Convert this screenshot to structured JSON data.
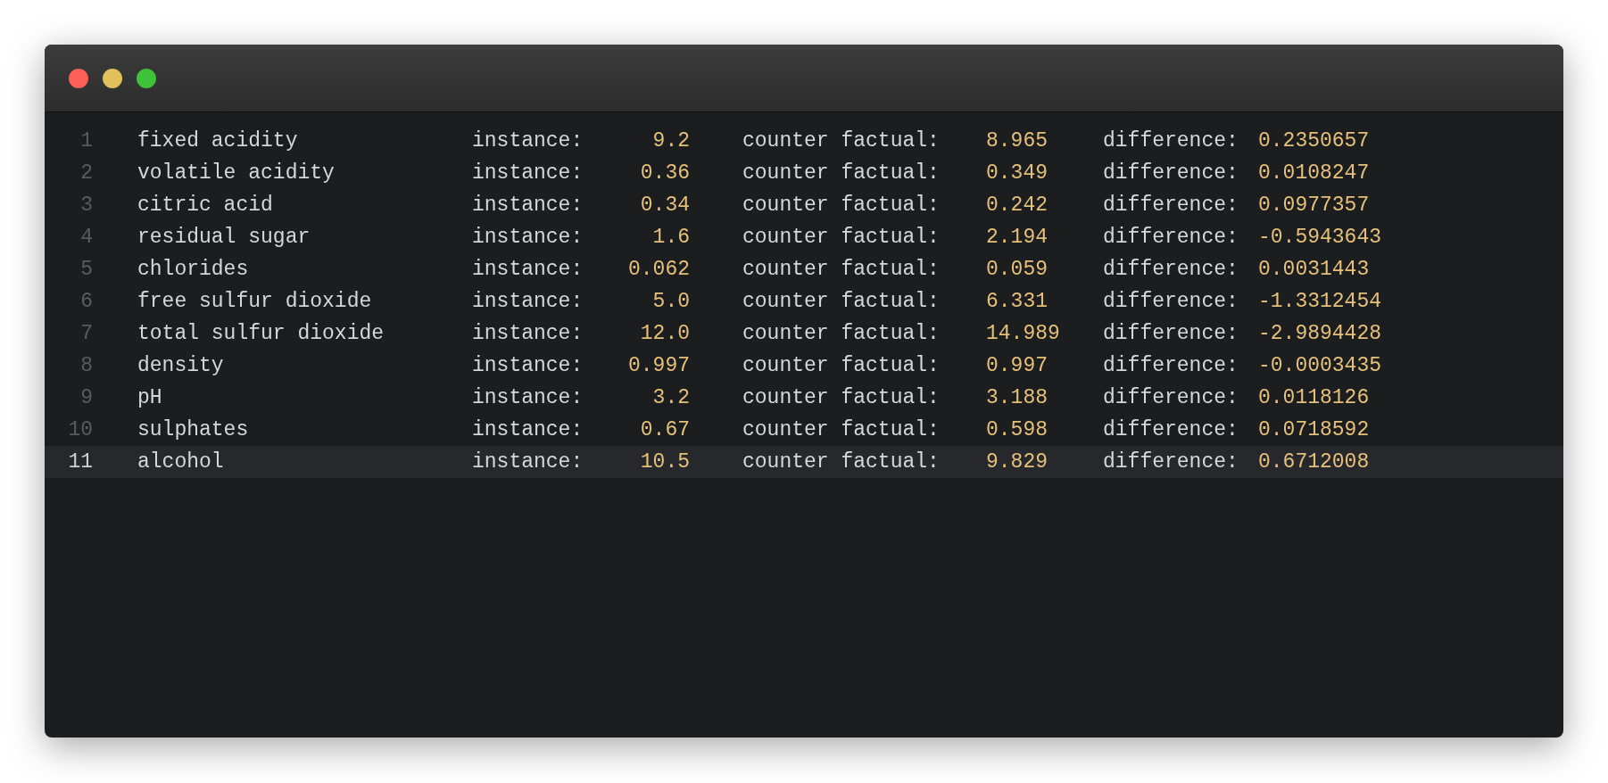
{
  "window": {
    "buttons": [
      {
        "color": "#fe5f57"
      },
      {
        "color": "#e2c05e"
      },
      {
        "color": "#3dc23a"
      }
    ]
  },
  "rows": [
    {
      "line": "1",
      "name": "fixed acidity",
      "instance_label": "instance:",
      "instance": "9.2",
      "counterfactual_label": "counter factual:",
      "counterfactual": "8.965",
      "difference_label": "difference:",
      "difference": "0.2350657",
      "selected": false
    },
    {
      "line": "2",
      "name": "volatile acidity",
      "instance_label": "instance:",
      "instance": "0.36",
      "counterfactual_label": "counter factual:",
      "counterfactual": "0.349",
      "difference_label": "difference:",
      "difference": "0.0108247",
      "selected": false
    },
    {
      "line": "3",
      "name": "citric acid",
      "instance_label": "instance:",
      "instance": "0.34",
      "counterfactual_label": "counter factual:",
      "counterfactual": "0.242",
      "difference_label": "difference:",
      "difference": "0.0977357",
      "selected": false
    },
    {
      "line": "4",
      "name": "residual sugar",
      "instance_label": "instance:",
      "instance": "1.6",
      "counterfactual_label": "counter factual:",
      "counterfactual": "2.194",
      "difference_label": "difference:",
      "difference": "-0.5943643",
      "selected": false
    },
    {
      "line": "5",
      "name": "chlorides",
      "instance_label": "instance:",
      "instance": "0.062",
      "counterfactual_label": "counter factual:",
      "counterfactual": "0.059",
      "difference_label": "difference:",
      "difference": "0.0031443",
      "selected": false
    },
    {
      "line": "6",
      "name": "free sulfur dioxide",
      "instance_label": "instance:",
      "instance": "5.0",
      "counterfactual_label": "counter factual:",
      "counterfactual": "6.331",
      "difference_label": "difference:",
      "difference": "-1.3312454",
      "selected": false
    },
    {
      "line": "7",
      "name": "total sulfur dioxide",
      "instance_label": "instance:",
      "instance": "12.0",
      "counterfactual_label": "counter factual:",
      "counterfactual": "14.989",
      "difference_label": "difference:",
      "difference": "-2.9894428",
      "selected": false
    },
    {
      "line": "8",
      "name": "density",
      "instance_label": "instance:",
      "instance": "0.997",
      "counterfactual_label": "counter factual:",
      "counterfactual": "0.997",
      "difference_label": "difference:",
      "difference": "-0.0003435",
      "selected": false
    },
    {
      "line": "9",
      "name": "pH",
      "instance_label": "instance:",
      "instance": "3.2",
      "counterfactual_label": "counter factual:",
      "counterfactual": "3.188",
      "difference_label": "difference:",
      "difference": "0.0118126",
      "selected": false
    },
    {
      "line": "10",
      "name": "sulphates",
      "instance_label": "instance:",
      "instance": "0.67",
      "counterfactual_label": "counter factual:",
      "counterfactual": "0.598",
      "difference_label": "difference:",
      "difference": "0.0718592",
      "selected": false
    },
    {
      "line": "11",
      "name": "alcohol",
      "instance_label": "instance:",
      "instance": "10.5",
      "counterfactual_label": "counter factual:",
      "counterfactual": "9.829",
      "difference_label": "difference:",
      "difference": "0.6712008",
      "selected": true
    }
  ]
}
